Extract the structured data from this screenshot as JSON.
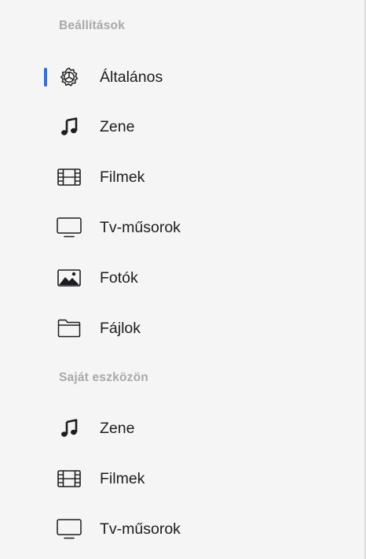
{
  "sections": [
    {
      "header": "Beállítások",
      "items": [
        {
          "label": "Általános",
          "icon": "gear-icon",
          "selected": true
        },
        {
          "label": "Zene",
          "icon": "music-note-icon",
          "selected": false
        },
        {
          "label": "Filmek",
          "icon": "film-strip-icon",
          "selected": false
        },
        {
          "label": "Tv-műsorok",
          "icon": "tv-icon",
          "selected": false
        },
        {
          "label": "Fotók",
          "icon": "photo-icon",
          "selected": false
        },
        {
          "label": "Fájlok",
          "icon": "folder-icon",
          "selected": false
        }
      ]
    },
    {
      "header": "Saját eszközön",
      "items": [
        {
          "label": "Zene",
          "icon": "music-note-icon",
          "selected": false
        },
        {
          "label": "Filmek",
          "icon": "film-strip-icon",
          "selected": false
        },
        {
          "label": "Tv-műsorok",
          "icon": "tv-icon",
          "selected": false
        }
      ]
    }
  ],
  "colors": {
    "background": "#f5f5f5",
    "header_text": "#a9a9a9",
    "item_text": "#1d1d1f",
    "selection_indicator": "#2f6fdf"
  }
}
